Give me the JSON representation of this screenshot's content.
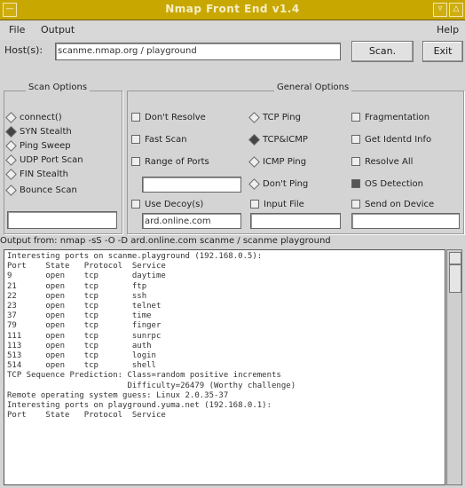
{
  "window": {
    "title": "Nmap Front End v1.4"
  },
  "menu": {
    "file": "File",
    "output": "Output",
    "help": "Help"
  },
  "host": {
    "label": "Host(s):",
    "value": "scanme.nmap.org / playground",
    "scan_label": "Scan.",
    "exit_label": "Exit"
  },
  "scan_options": {
    "title": "Scan Options",
    "items": [
      {
        "label": "connect()",
        "selected": false
      },
      {
        "label": "SYN Stealth",
        "selected": true
      },
      {
        "label": "Ping Sweep",
        "selected": false
      },
      {
        "label": "UDP Port Scan",
        "selected": false
      },
      {
        "label": "FIN Stealth",
        "selected": false
      },
      {
        "label": "Bounce Scan",
        "selected": false
      }
    ]
  },
  "general_options": {
    "title": "General Options",
    "col1": [
      {
        "label": "Don't Resolve",
        "checked": false
      },
      {
        "label": "Fast Scan",
        "checked": false
      },
      {
        "label": "Range of Ports",
        "checked": false
      },
      {
        "label": "Use Decoy(s)",
        "checked": false
      }
    ],
    "col2": [
      {
        "label": "TCP Ping",
        "selected": false
      },
      {
        "label": "TCP&ICMP",
        "selected": true
      },
      {
        "label": "ICMP Ping",
        "selected": false
      },
      {
        "label": "Don't Ping",
        "selected": false
      },
      {
        "label": "Input File",
        "checked": false
      }
    ],
    "col3": [
      {
        "label": "Fragmentation",
        "checked": false
      },
      {
        "label": "Get Identd Info",
        "checked": false
      },
      {
        "label": "Resolve All",
        "checked": false
      },
      {
        "label": "OS Detection",
        "checked": true
      },
      {
        "label": "Send on Device",
        "checked": false
      }
    ],
    "decoy_value": "ard.online.com"
  },
  "status_line": "Output from: nmap -sS -O -D ard.online.com scanme / scanme playground",
  "output_lines": [
    "Interesting ports on scanme.playground (192.168.0.5):",
    "Port    State   Protocol  Service",
    "9       open    tcp       daytime",
    "21      open    tcp       ftp",
    "22      open    tcp       ssh",
    "23      open    tcp       telnet",
    "37      open    tcp       time",
    "79      open    tcp       finger",
    "111     open    tcp       sunrpc",
    "113     open    tcp       auth",
    "513     open    tcp       login",
    "514     open    tcp       shell",
    "",
    "TCP Sequence Prediction: Class=random positive increments",
    "                         Difficulty=26479 (Worthy challenge)",
    "Remote operating system guess: Linux 2.0.35-37",
    "",
    "Interesting ports on playground.yuma.net (192.168.0.1):",
    "Port    State   Protocol  Service"
  ]
}
